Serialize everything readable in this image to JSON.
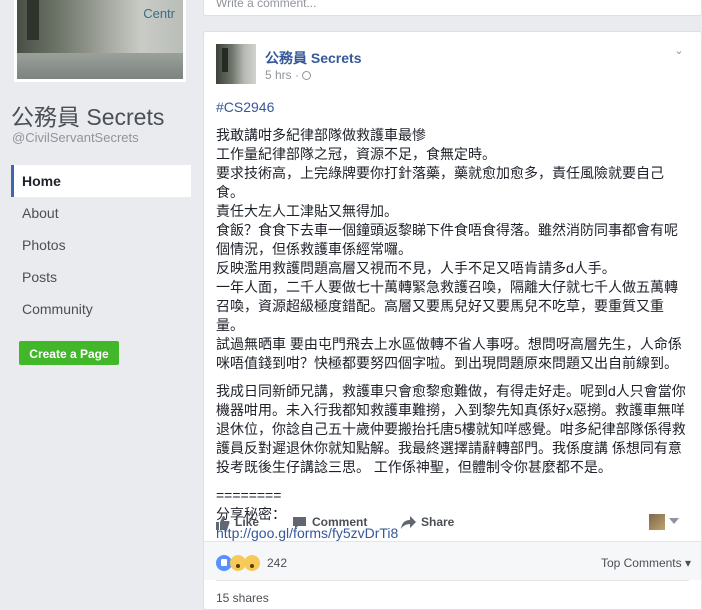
{
  "page": {
    "title": "公務員 Secrets",
    "handle": "@CivilServantSecrets"
  },
  "nav": {
    "items": [
      {
        "label": "Home",
        "active": true
      },
      {
        "label": "About"
      },
      {
        "label": "Photos"
      },
      {
        "label": "Posts"
      },
      {
        "label": "Community"
      }
    ],
    "create_label": "Create a Page"
  },
  "previous_post": {
    "write_comment_placeholder": "Write a comment..."
  },
  "post": {
    "author": "公務員 Secrets",
    "time": "5 hrs ·",
    "tag": "#CS2946",
    "paragraphs": [
      "我敢講咁多紀律部隊做救護車最慘\n工作量紀律部隊之冠，資源不足，食無定時。\n要求技術高，上完綠牌要你打針落藥，藥就愈加愈多，責任風險就要自己食。\n責任大左人工津貼又無得加。\n食飯？食食下去車一個鐘頭返黎睇下件食唔食得落。雖然消防同事都會有呢個情況，但係救護車係經常囉。\n反映濫用救護問題高層又視而不見，人手不足又唔肯請多d人手。\n一年人面，二千人要做七十萬轉緊急救護召喚，隔離大仔就七千人做五萬轉召喚，資源超級極度錯配。高層又要馬兒好又要馬兒不吃草，要重質又重量。\n試過無晒車 要由屯門飛去上水區做轉不省人事呀。想問呀高層先生，人命係咪唔值錢到咁？快極都要努四個字啦。到出現問題原來問題又出自前線到。",
      "我成日同新師兄講，救護車只會愈黎愈難做，有得走好走。呢到d人只會當你機器咁用。未入行我都知救護車難撈，入到黎先知真係好x惡撈。救護車無咩退休位，你諗自己五十歲仲要搬抬托唐5樓就知咩感覺。咁多紀律部隊係得救護員反對遲退休你就知點解。我最終選擇請辭轉部門。我係度講 係想同有意投考既後生仔講諗三思。 工作係神聖，但體制令你甚麼都不是。",
      "========\n分享秘密："
    ],
    "link": "http://goo.gl/forms/fy5zvDrTi8",
    "actions": {
      "like": "Like",
      "comment": "Comment",
      "share": "Share"
    },
    "reaction_count": "242",
    "top_comments": "Top Comments",
    "shares": "15 shares"
  },
  "colors": {
    "link_blue": "#365899",
    "button_green": "#42b72a",
    "background": "#e9ebee",
    "nav_active_border": "#4267b2"
  },
  "icons": [
    "globe-icon",
    "chevron-down-icon",
    "like-icon",
    "comment-icon",
    "share-icon",
    "like-reaction-icon",
    "sad-reaction-icon",
    "wow-reaction-icon"
  ]
}
